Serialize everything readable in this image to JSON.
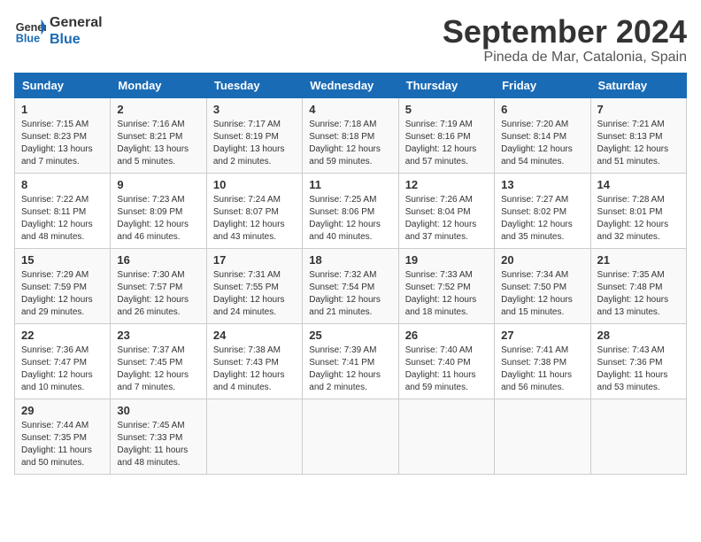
{
  "header": {
    "logo_line1": "General",
    "logo_line2": "Blue",
    "title": "September 2024",
    "subtitle": "Pineda de Mar, Catalonia, Spain"
  },
  "weekdays": [
    "Sunday",
    "Monday",
    "Tuesday",
    "Wednesday",
    "Thursday",
    "Friday",
    "Saturday"
  ],
  "weeks": [
    [
      {
        "day": "1",
        "sunrise": "Sunrise: 7:15 AM",
        "sunset": "Sunset: 8:23 PM",
        "daylight": "Daylight: 13 hours and 7 minutes."
      },
      {
        "day": "2",
        "sunrise": "Sunrise: 7:16 AM",
        "sunset": "Sunset: 8:21 PM",
        "daylight": "Daylight: 13 hours and 5 minutes."
      },
      {
        "day": "3",
        "sunrise": "Sunrise: 7:17 AM",
        "sunset": "Sunset: 8:19 PM",
        "daylight": "Daylight: 13 hours and 2 minutes."
      },
      {
        "day": "4",
        "sunrise": "Sunrise: 7:18 AM",
        "sunset": "Sunset: 8:18 PM",
        "daylight": "Daylight: 12 hours and 59 minutes."
      },
      {
        "day": "5",
        "sunrise": "Sunrise: 7:19 AM",
        "sunset": "Sunset: 8:16 PM",
        "daylight": "Daylight: 12 hours and 57 minutes."
      },
      {
        "day": "6",
        "sunrise": "Sunrise: 7:20 AM",
        "sunset": "Sunset: 8:14 PM",
        "daylight": "Daylight: 12 hours and 54 minutes."
      },
      {
        "day": "7",
        "sunrise": "Sunrise: 7:21 AM",
        "sunset": "Sunset: 8:13 PM",
        "daylight": "Daylight: 12 hours and 51 minutes."
      }
    ],
    [
      {
        "day": "8",
        "sunrise": "Sunrise: 7:22 AM",
        "sunset": "Sunset: 8:11 PM",
        "daylight": "Daylight: 12 hours and 48 minutes."
      },
      {
        "day": "9",
        "sunrise": "Sunrise: 7:23 AM",
        "sunset": "Sunset: 8:09 PM",
        "daylight": "Daylight: 12 hours and 46 minutes."
      },
      {
        "day": "10",
        "sunrise": "Sunrise: 7:24 AM",
        "sunset": "Sunset: 8:07 PM",
        "daylight": "Daylight: 12 hours and 43 minutes."
      },
      {
        "day": "11",
        "sunrise": "Sunrise: 7:25 AM",
        "sunset": "Sunset: 8:06 PM",
        "daylight": "Daylight: 12 hours and 40 minutes."
      },
      {
        "day": "12",
        "sunrise": "Sunrise: 7:26 AM",
        "sunset": "Sunset: 8:04 PM",
        "daylight": "Daylight: 12 hours and 37 minutes."
      },
      {
        "day": "13",
        "sunrise": "Sunrise: 7:27 AM",
        "sunset": "Sunset: 8:02 PM",
        "daylight": "Daylight: 12 hours and 35 minutes."
      },
      {
        "day": "14",
        "sunrise": "Sunrise: 7:28 AM",
        "sunset": "Sunset: 8:01 PM",
        "daylight": "Daylight: 12 hours and 32 minutes."
      }
    ],
    [
      {
        "day": "15",
        "sunrise": "Sunrise: 7:29 AM",
        "sunset": "Sunset: 7:59 PM",
        "daylight": "Daylight: 12 hours and 29 minutes."
      },
      {
        "day": "16",
        "sunrise": "Sunrise: 7:30 AM",
        "sunset": "Sunset: 7:57 PM",
        "daylight": "Daylight: 12 hours and 26 minutes."
      },
      {
        "day": "17",
        "sunrise": "Sunrise: 7:31 AM",
        "sunset": "Sunset: 7:55 PM",
        "daylight": "Daylight: 12 hours and 24 minutes."
      },
      {
        "day": "18",
        "sunrise": "Sunrise: 7:32 AM",
        "sunset": "Sunset: 7:54 PM",
        "daylight": "Daylight: 12 hours and 21 minutes."
      },
      {
        "day": "19",
        "sunrise": "Sunrise: 7:33 AM",
        "sunset": "Sunset: 7:52 PM",
        "daylight": "Daylight: 12 hours and 18 minutes."
      },
      {
        "day": "20",
        "sunrise": "Sunrise: 7:34 AM",
        "sunset": "Sunset: 7:50 PM",
        "daylight": "Daylight: 12 hours and 15 minutes."
      },
      {
        "day": "21",
        "sunrise": "Sunrise: 7:35 AM",
        "sunset": "Sunset: 7:48 PM",
        "daylight": "Daylight: 12 hours and 13 minutes."
      }
    ],
    [
      {
        "day": "22",
        "sunrise": "Sunrise: 7:36 AM",
        "sunset": "Sunset: 7:47 PM",
        "daylight": "Daylight: 12 hours and 10 minutes."
      },
      {
        "day": "23",
        "sunrise": "Sunrise: 7:37 AM",
        "sunset": "Sunset: 7:45 PM",
        "daylight": "Daylight: 12 hours and 7 minutes."
      },
      {
        "day": "24",
        "sunrise": "Sunrise: 7:38 AM",
        "sunset": "Sunset: 7:43 PM",
        "daylight": "Daylight: 12 hours and 4 minutes."
      },
      {
        "day": "25",
        "sunrise": "Sunrise: 7:39 AM",
        "sunset": "Sunset: 7:41 PM",
        "daylight": "Daylight: 12 hours and 2 minutes."
      },
      {
        "day": "26",
        "sunrise": "Sunrise: 7:40 AM",
        "sunset": "Sunset: 7:40 PM",
        "daylight": "Daylight: 11 hours and 59 minutes."
      },
      {
        "day": "27",
        "sunrise": "Sunrise: 7:41 AM",
        "sunset": "Sunset: 7:38 PM",
        "daylight": "Daylight: 11 hours and 56 minutes."
      },
      {
        "day": "28",
        "sunrise": "Sunrise: 7:43 AM",
        "sunset": "Sunset: 7:36 PM",
        "daylight": "Daylight: 11 hours and 53 minutes."
      }
    ],
    [
      {
        "day": "29",
        "sunrise": "Sunrise: 7:44 AM",
        "sunset": "Sunset: 7:35 PM",
        "daylight": "Daylight: 11 hours and 50 minutes."
      },
      {
        "day": "30",
        "sunrise": "Sunrise: 7:45 AM",
        "sunset": "Sunset: 7:33 PM",
        "daylight": "Daylight: 11 hours and 48 minutes."
      },
      null,
      null,
      null,
      null,
      null
    ]
  ]
}
